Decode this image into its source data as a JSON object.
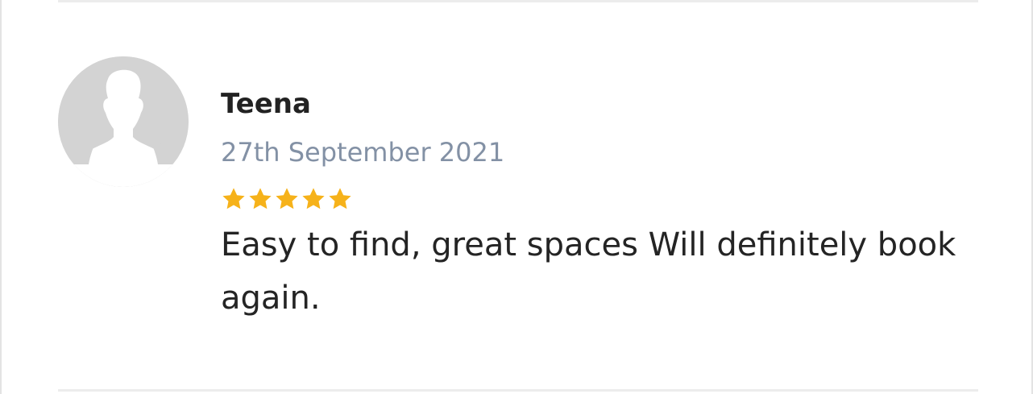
{
  "review": {
    "reviewer_name": "Teena",
    "date": "27th September 2021",
    "rating": 5,
    "rating_max": 5,
    "text": "Easy to find, great spaces Will definitely book again.",
    "star_color": "#f6b21a",
    "avatar_icon": "user-placeholder-icon"
  }
}
